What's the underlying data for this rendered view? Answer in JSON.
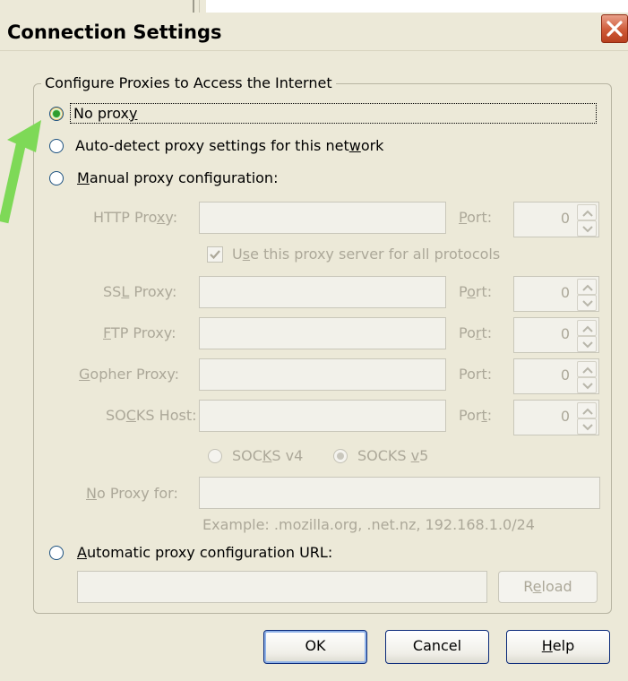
{
  "dialog": {
    "title": "Connection Settings",
    "group_label": "Configure Proxies to Access the Internet"
  },
  "options": {
    "no_proxy": {
      "pre": "No prox",
      "key": "y",
      "post": "",
      "selected": true
    },
    "auto_detect": {
      "pre": "Auto-detect proxy settings for this net",
      "key": "w",
      "post": "ork",
      "selected": false
    },
    "manual": {
      "pre": "",
      "key": "M",
      "post": "anual proxy configuration:",
      "selected": false
    },
    "auto_url": {
      "pre": "",
      "key": "A",
      "post": "utomatic proxy configuration URL:",
      "selected": false
    }
  },
  "proxies": {
    "http": {
      "pre": "HTTP Pro",
      "key": "x",
      "post": "y:",
      "value": "",
      "port_pre": "",
      "port_key": "P",
      "port_post": "ort:",
      "port": "0"
    },
    "ssl": {
      "pre": "SS",
      "key": "L",
      "post": " Proxy:",
      "value": "",
      "port_pre": "P",
      "port_key": "o",
      "port_post": "rt:",
      "port": "0"
    },
    "ftp": {
      "pre": "",
      "key": "F",
      "post": "TP Proxy:",
      "value": "",
      "port_pre": "Po",
      "port_key": "r",
      "port_post": "t:",
      "port": "0"
    },
    "gopher": {
      "pre": "",
      "key": "G",
      "post": "opher Proxy:",
      "value": "",
      "port_pre": "Port:",
      "port_key": "",
      "port_post": "",
      "port": "0"
    },
    "socks": {
      "pre": "SO",
      "key": "C",
      "post": "KS Host:",
      "value": "",
      "port_pre": "Por",
      "port_key": "t",
      "port_post": ":",
      "port": "0"
    }
  },
  "share_checkbox": {
    "pre": "U",
    "key": "s",
    "post": "e this proxy server for all protocols",
    "checked": true
  },
  "socks_versions": {
    "v4": {
      "pre": "SOC",
      "key": "K",
      "post": "S v4",
      "selected": false
    },
    "v5": {
      "pre": "SOCKS ",
      "key": "v",
      "post": "5",
      "selected": true
    }
  },
  "no_proxy_for": {
    "pre": "",
    "key": "N",
    "post": "o Proxy for:",
    "value": "",
    "example": "Example: .mozilla.org, .net.nz, 192.168.1.0/24"
  },
  "auto_url_field": {
    "value": ""
  },
  "buttons": {
    "reload": {
      "pre": "R",
      "key": "e",
      "post": "load"
    },
    "ok": "OK",
    "cancel": "Cancel",
    "help": {
      "pre": "",
      "key": "H",
      "post": "elp"
    }
  },
  "colors": {
    "accent_arrow": "#7ed957",
    "radio_selected": "#2f9d2f",
    "close_button": "#cf5a38"
  }
}
